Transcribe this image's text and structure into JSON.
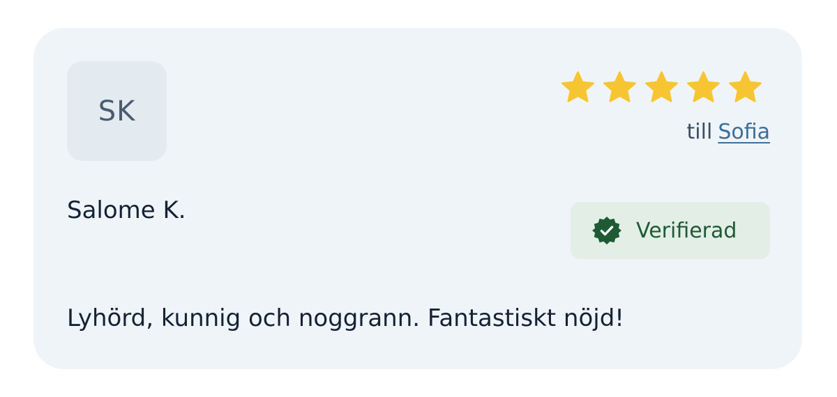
{
  "review": {
    "avatar_initials": "SK",
    "rating": 5,
    "rating_max": 5,
    "star_color": "#f6c531",
    "to_prefix": "till",
    "to_name": "Sofia",
    "reviewer_name": "Salome K.",
    "badge_label": "Verifierad",
    "badge_icon": "verified-check-icon",
    "badge_color": "#1f5a35",
    "comment": "Lyhörd, kunnig och noggrann. Fantastiskt nöjd!"
  }
}
